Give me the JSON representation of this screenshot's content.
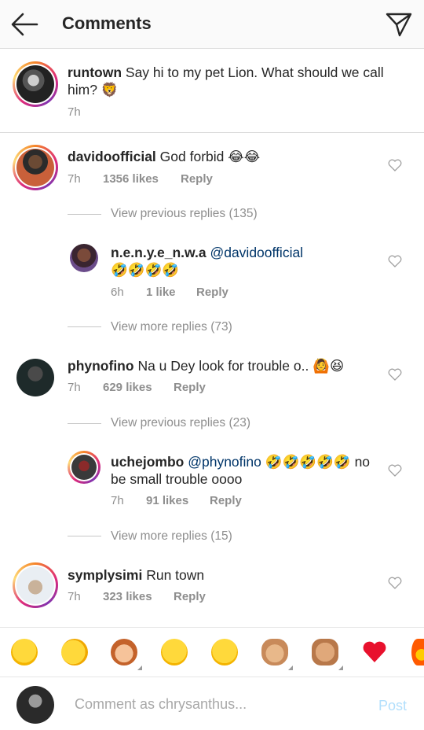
{
  "header": {
    "title": "Comments"
  },
  "caption": {
    "username": "runtown",
    "text": "Say hi to my pet Lion. What should we call him? 🦁",
    "time": "7h"
  },
  "comments": [
    {
      "username": "davidoofficial",
      "text": "God forbid 😂😂",
      "time": "7h",
      "likes": "1356 likes",
      "reply": "Reply",
      "view_previous": "View previous replies (135)",
      "replies": [
        {
          "username": "n.e.n.y.e_n.w.a",
          "mention": "@davidoofficial",
          "text": "🤣🤣🤣🤣",
          "time": "6h",
          "likes": "1 like",
          "reply": "Reply"
        }
      ],
      "view_more": "View more replies (73)"
    },
    {
      "username": "phynofino",
      "text": "Na u Dey look for trouble o.. 🙆😆",
      "time": "7h",
      "likes": "629 likes",
      "reply": "Reply",
      "view_previous": "View previous replies (23)",
      "replies": [
        {
          "username": "uchejombo",
          "mention": "@phynofino",
          "text_line1": "🤣🤣🤣🤣🤣 no",
          "text_line2": "be small trouble oooo",
          "time": "7h",
          "likes": "91 likes",
          "reply": "Reply"
        }
      ],
      "view_more": "View more replies (15)"
    },
    {
      "username": "symplysimi",
      "text": "Run town",
      "time": "7h",
      "likes": "323 likes",
      "reply": "Reply"
    }
  ],
  "emoji_bar": [
    "😂",
    "🤣",
    "🙆",
    "🙄",
    "😁",
    "👌",
    "👊",
    "❤️",
    "🔥"
  ],
  "compose": {
    "placeholder": "Comment as chrysanthus...",
    "post_label": "Post"
  },
  "colors": {
    "link_blue": "#003569",
    "muted": "#8e8e8e",
    "post_disabled": "#b2dffc"
  }
}
